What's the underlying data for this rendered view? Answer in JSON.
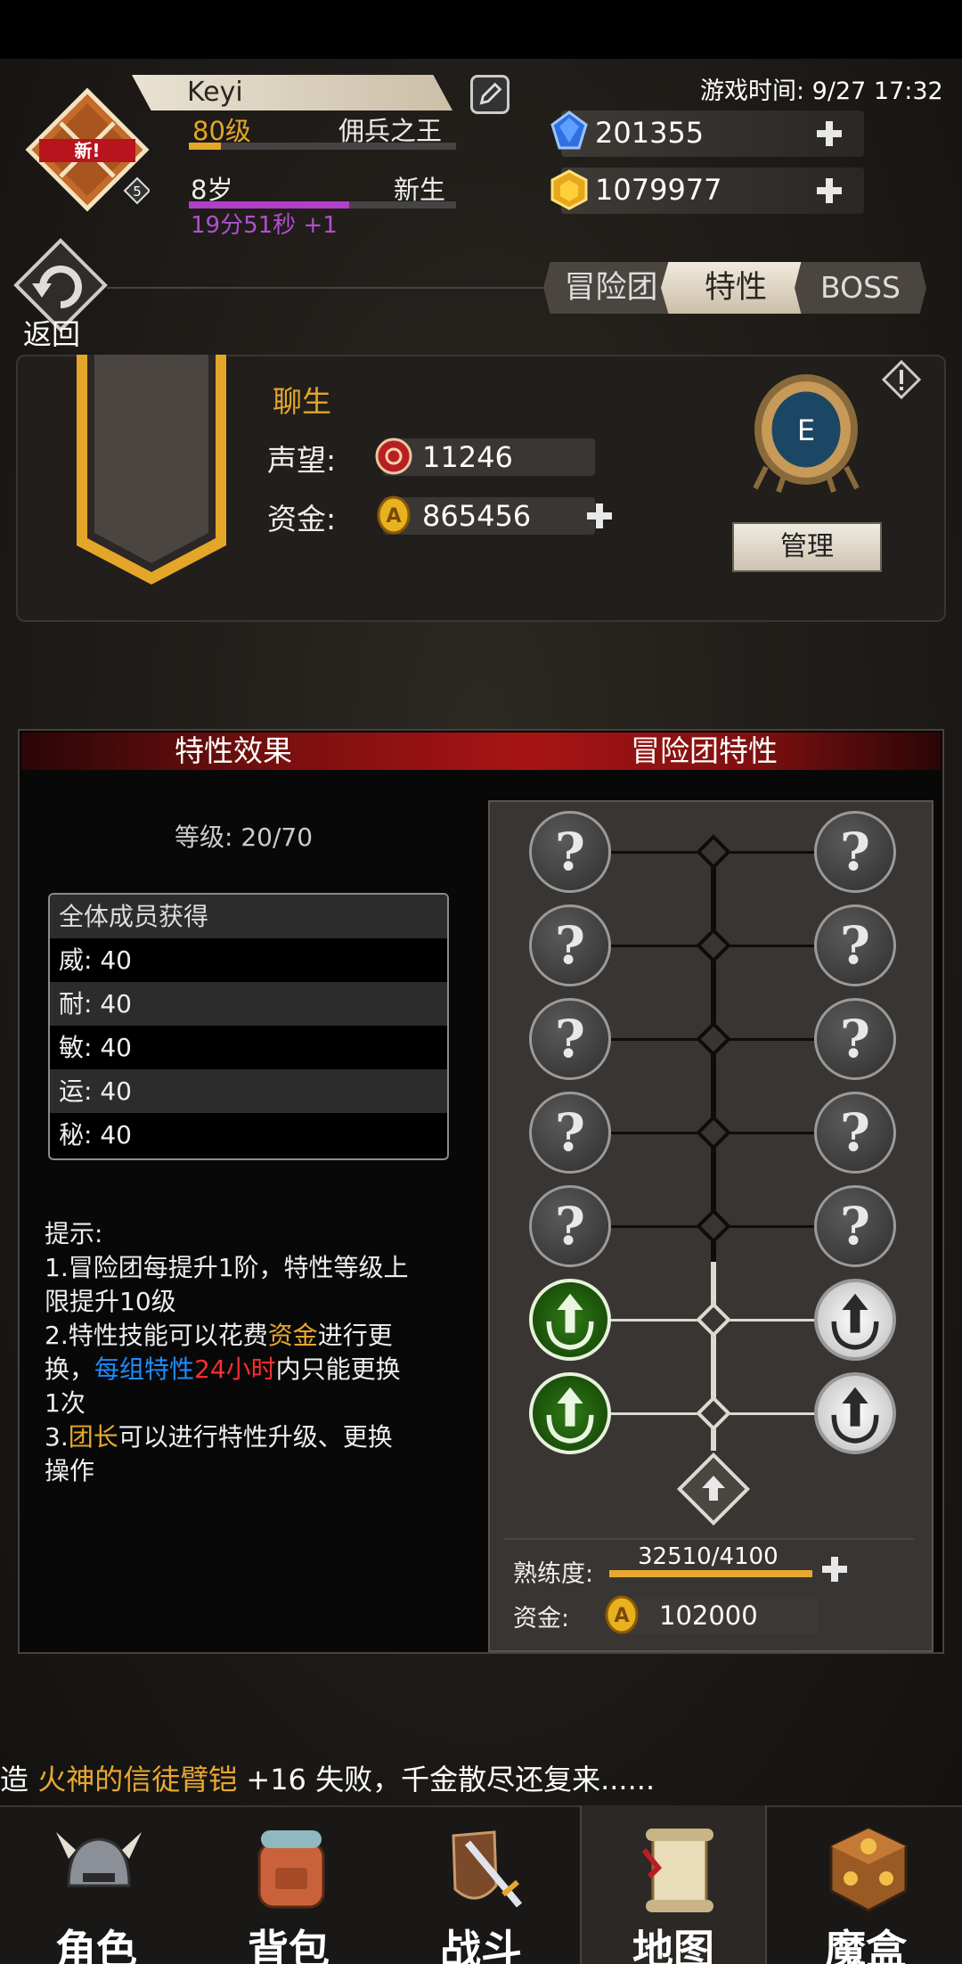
{
  "header": {
    "name": "Keyi",
    "level": "80级",
    "rank_title": "佣兵之王",
    "level_progress": 0.12,
    "age": "8岁",
    "age_title": "新生",
    "age_progress": 0.6,
    "timer": "19分51秒 +1",
    "emblem_badge": "新!",
    "emblem_count": "5",
    "game_time": "游戏时间: 9/27 17:32",
    "diamonds": "201355",
    "gold": "1079977"
  },
  "nav_bar": {
    "back_label": "返回",
    "tabs": [
      {
        "label": "冒险团",
        "active": false
      },
      {
        "label": "特性",
        "active": true
      },
      {
        "label": "BOSS",
        "active": false
      }
    ]
  },
  "org": {
    "name": "聊生",
    "reputation_label": "声望:",
    "reputation": "11246",
    "funds_label": "资金:",
    "funds": "865456",
    "rank_letter": "E",
    "manage_label": "管理"
  },
  "traits": {
    "header_left": "特性效果",
    "header_right": "冒险团特性",
    "grade": "等级: 20/70",
    "table_head": "全体成员获得",
    "stats": [
      "威: 40",
      "耐: 40",
      "敏: 40",
      "运: 40",
      "秘: 40"
    ],
    "tips": {
      "title": "提示:",
      "l1": "1.冒险团每提升1阶，特性等级上限提升10级",
      "l2a": "2.特性技能可以花费",
      "l2b": "资金",
      "l2c": "进行更换，",
      "l2d": "每组特性",
      "l2e": "24小时",
      "l2f": "内只能更换1次",
      "l3a": "3.",
      "l3b": "团长",
      "l3c": "可以进行特性升级、更换操作"
    },
    "tree": {
      "locked_symbol": "?",
      "rows": [
        {
          "left": "locked",
          "right": "locked"
        },
        {
          "left": "locked",
          "right": "locked"
        },
        {
          "left": "locked",
          "right": "locked"
        },
        {
          "left": "locked",
          "right": "locked"
        },
        {
          "left": "locked",
          "right": "locked"
        },
        {
          "left": "active",
          "right": "inactive"
        },
        {
          "left": "active",
          "right": "inactive"
        }
      ]
    },
    "proficiency_label": "熟练度:",
    "proficiency": "32510/4100",
    "cost_label": "资金:",
    "cost": "102000"
  },
  "ticker": {
    "prefix": "造 ",
    "item": "火神的信徒臂铠",
    "suffix": " +16 失败，千金散尽还复来......"
  },
  "bottom_nav": [
    {
      "label": "角色",
      "icon": "helmet-icon",
      "active": false
    },
    {
      "label": "背包",
      "icon": "backpack-icon",
      "active": false
    },
    {
      "label": "战斗",
      "icon": "sword-shield-icon",
      "active": false
    },
    {
      "label": "地图",
      "icon": "scroll-map-icon",
      "active": true
    },
    {
      "label": "魔盒",
      "icon": "magic-box-icon",
      "active": false
    }
  ],
  "colors": {
    "gold": "#e4a629",
    "purple": "#b040c8",
    "red_header": "#a81414",
    "active_node": "#2f7a16"
  }
}
